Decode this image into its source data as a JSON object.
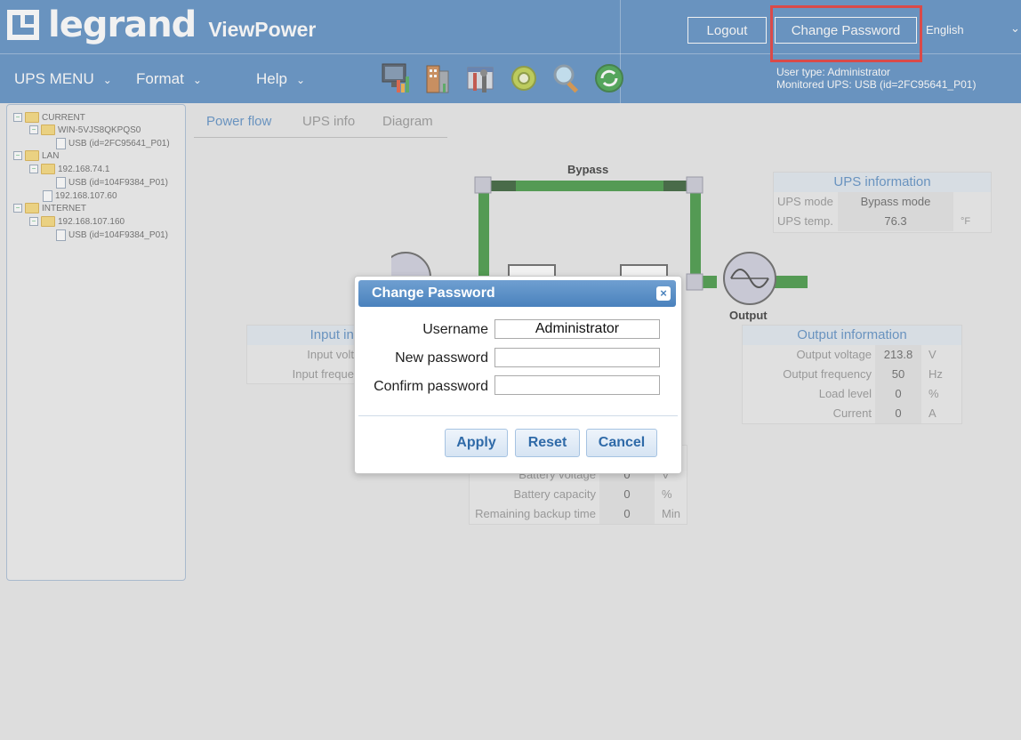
{
  "header": {
    "logo": "legrand",
    "app_name": "ViewPower",
    "logout_label": "Logout",
    "change_password_label": "Change Password",
    "language": "English",
    "menus": [
      {
        "label": "UPS MENU"
      },
      {
        "label": "Format"
      },
      {
        "label": "Help"
      }
    ],
    "toolbar_icons": [
      "monitor-chart-icon",
      "building-chart-icon",
      "tools-icon",
      "gear-icon",
      "magnifier-icon",
      "refresh-icon"
    ],
    "user_type": "User type: Administrator",
    "monitored_ups": "Monitored UPS: USB (id=2FC95641_P01)"
  },
  "tree": [
    {
      "label": "CURRENT",
      "kind": "folder",
      "level": 0
    },
    {
      "label": "WIN-5VJS8QKPQS0",
      "kind": "folder",
      "level": 1
    },
    {
      "label": "USB (id=2FC95641_P01)",
      "kind": "file",
      "level": 2
    },
    {
      "label": "LAN",
      "kind": "folder",
      "level": 0
    },
    {
      "label": "192.168.74.1",
      "kind": "folder",
      "level": 1
    },
    {
      "label": "USB (id=104F9384_P01)",
      "kind": "file",
      "level": 2
    },
    {
      "label": "192.168.107.60",
      "kind": "file",
      "level": 1
    },
    {
      "label": "INTERNET",
      "kind": "folder",
      "level": 0
    },
    {
      "label": "192.168.107.160",
      "kind": "folder",
      "level": 1
    },
    {
      "label": "USB (id=104F9384_P01)",
      "kind": "file",
      "level": 2
    }
  ],
  "tabs": [
    {
      "label": "Power flow",
      "active": true
    },
    {
      "label": "UPS info",
      "active": false
    },
    {
      "label": "Diagram",
      "active": false
    }
  ],
  "flow": {
    "bypass_label": "Bypass",
    "output_label": "Output",
    "path_color": "#2e8b2e"
  },
  "ups_info": {
    "title": "UPS information",
    "rows": [
      {
        "label": "UPS mode",
        "value": "Bypass mode",
        "unit": ""
      },
      {
        "label": "UPS temp.",
        "value": "76.3",
        "unit": "°F"
      }
    ]
  },
  "input_info": {
    "title": "Input inf",
    "rows": [
      {
        "label": "Input volt"
      },
      {
        "label": "Input freque"
      }
    ]
  },
  "output_info": {
    "title": "Output information",
    "rows": [
      {
        "label": "Output voltage",
        "value": "213.8",
        "unit": "V"
      },
      {
        "label": "Output frequency",
        "value": "50",
        "unit": "Hz"
      },
      {
        "label": "Load level",
        "value": "0",
        "unit": "%"
      },
      {
        "label": "Current",
        "value": "0",
        "unit": "A"
      }
    ]
  },
  "battery_info": {
    "rows": [
      {
        "label": "Battery voltage",
        "value": "0",
        "unit": "V"
      },
      {
        "label": "Battery capacity",
        "value": "0",
        "unit": "%"
      },
      {
        "label": "Remaining backup time",
        "value": "0",
        "unit": "Min"
      }
    ]
  },
  "dialog": {
    "title": "Change Password",
    "username_label": "Username",
    "username_value": "Administrator",
    "new_password_label": "New password",
    "confirm_password_label": "Confirm password",
    "apply_label": "Apply",
    "reset_label": "Reset",
    "cancel_label": "Cancel"
  }
}
